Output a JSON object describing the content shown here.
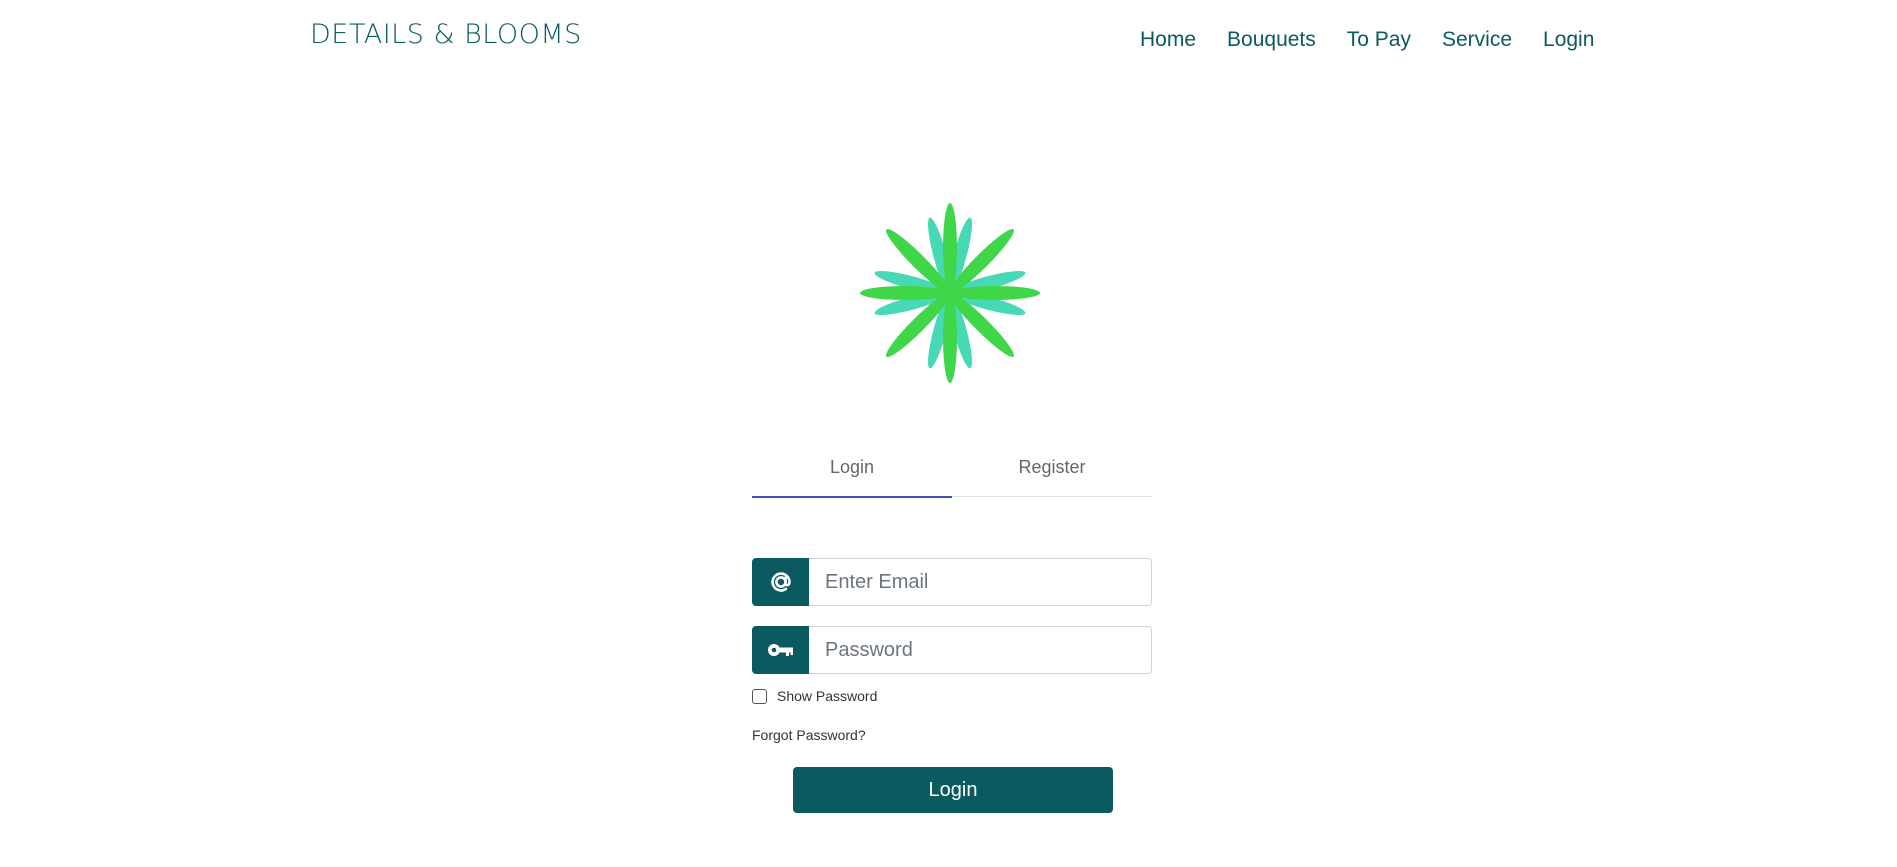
{
  "header": {
    "brand": "DETAILS & BLOOMS",
    "nav": [
      {
        "label": "Home"
      },
      {
        "label": "Bouquets"
      },
      {
        "label": "To Pay"
      },
      {
        "label": "Service"
      },
      {
        "label": "Login"
      }
    ]
  },
  "logo": {
    "icon": "flower-logo-icon",
    "colors": {
      "petal_primary": "#3fd64a",
      "petal_secondary": "#47d9b5"
    }
  },
  "tabs": [
    {
      "label": "Login",
      "active": true
    },
    {
      "label": "Register",
      "active": false
    }
  ],
  "form": {
    "email": {
      "placeholder": "Enter Email",
      "value": "",
      "icon": "at-sign-icon"
    },
    "password": {
      "placeholder": "Password",
      "value": "",
      "icon": "key-icon"
    },
    "show_password": {
      "label": "Show Password",
      "checked": false
    },
    "forgot_password": "Forgot Password?",
    "submit_label": "Login"
  },
  "colors": {
    "primary": "#0b5a5f",
    "tab_active_underline": "#3f51b5"
  }
}
